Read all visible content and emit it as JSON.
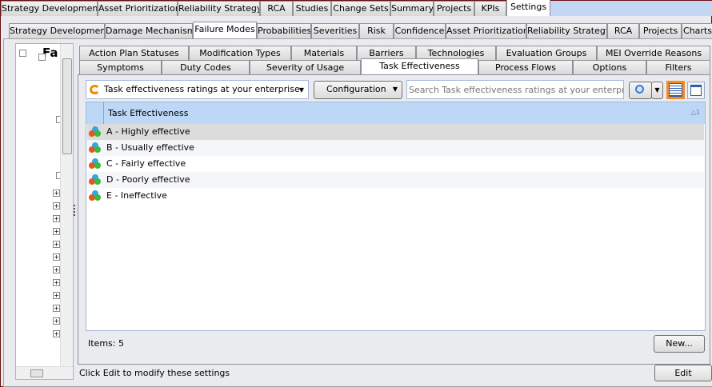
{
  "top_tabs": [
    "Strategy Development",
    "Asset Prioritization",
    "Reliability Strategy",
    "RCA",
    "Studies",
    "Change Sets",
    "Summary",
    "Projects",
    "KPIs",
    "Settings"
  ],
  "settings_tabs": [
    "Strategy Development",
    "Damage Mechanisms",
    "Failure Modes",
    "Probabilities",
    "Severities",
    "Risk",
    "Confidence",
    "Asset Prioritization",
    "Reliability Strategy",
    "RCA",
    "Projects",
    "Charts"
  ],
  "sub_tabs_row1": [
    "Action Plan Statuses",
    "Modification Types",
    "Materials",
    "Barriers",
    "Technologies",
    "Evaluation Groups",
    "MEI Override Reasons"
  ],
  "sub_tabs_row2": [
    "Symptoms",
    "Duty Codes",
    "Severity of Usage",
    "Task Effectiveness",
    "Process Flows",
    "Options",
    "Filters"
  ],
  "tree": {
    "root_label": "Fa"
  },
  "toolbar": {
    "scope_select": "Task effectiveness ratings at your enterprise",
    "configuration": "Configuration",
    "search_placeholder": "Search Task effectiveness ratings at your enterprise  (C"
  },
  "grid": {
    "column": "Task Effectiveness",
    "sort_indicator": "1",
    "rows": [
      "A - Highly effective",
      "B - Usually effective",
      "C - Fairly effective",
      "D - Poorly effective",
      "E - Ineffective"
    ]
  },
  "footer": {
    "items": "Items: 5",
    "new": "New..."
  },
  "status": {
    "text": "Click Edit to modify these settings",
    "edit": "Edit"
  }
}
